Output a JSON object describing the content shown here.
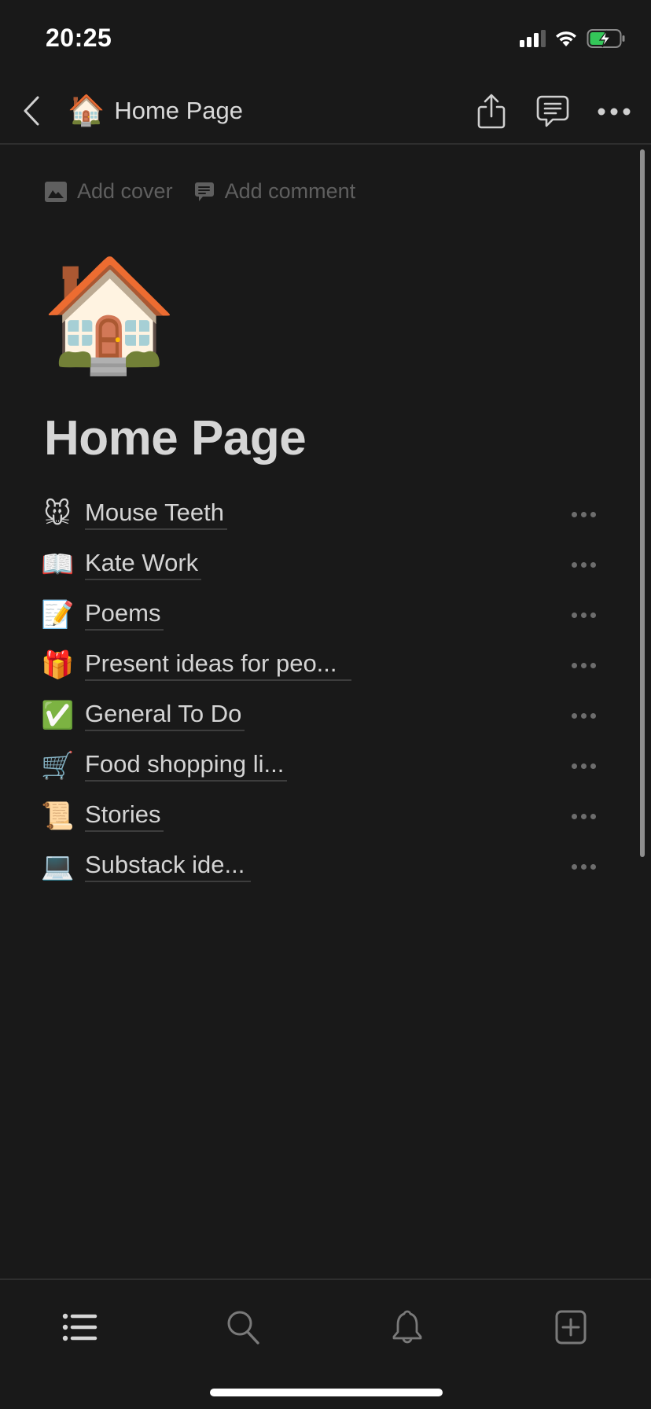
{
  "status_bar": {
    "time": "20:25",
    "signal_bars_filled": 3,
    "signal_bars_total": 4,
    "wifi_icon": "wifi-icon",
    "battery_icon": "battery-charging-icon",
    "battery_level": 0.5,
    "battery_color": "#34c759"
  },
  "nav_header": {
    "back_icon": "chevron-left-icon",
    "emoji": "🏠",
    "title": "Home Page",
    "actions": [
      {
        "name": "share",
        "icon": "share-icon"
      },
      {
        "name": "comments",
        "icon": "comment-icon"
      },
      {
        "name": "more",
        "icon": "ellipsis-icon"
      }
    ]
  },
  "page_actions": {
    "add_cover": {
      "label": "Add cover",
      "icon": "image-icon"
    },
    "add_comment": {
      "label": "Add comment",
      "icon": "comment-icon"
    }
  },
  "page": {
    "icon": "🏠",
    "title": "Home Page"
  },
  "subpages": [
    {
      "emoji": "🐭",
      "label": "Mouse Teeth"
    },
    {
      "emoji": "📖",
      "label": "Kate Work"
    },
    {
      "emoji": "📝",
      "label": "Poems"
    },
    {
      "emoji": "🎁",
      "label": "Present ideas for peo..."
    },
    {
      "emoji": "✅",
      "label": "General To Do"
    },
    {
      "emoji": "🛒",
      "label": "Food shopping li..."
    },
    {
      "emoji": "📜",
      "label": "Stories"
    },
    {
      "emoji": "💻",
      "label": "Substack ide..."
    }
  ],
  "tab_bar": {
    "tabs": [
      {
        "name": "sidebar",
        "icon": "list-icon"
      },
      {
        "name": "search",
        "icon": "search-icon"
      },
      {
        "name": "updates",
        "icon": "bell-icon"
      },
      {
        "name": "new-page",
        "icon": "new-page-icon"
      }
    ]
  },
  "colors": {
    "background": "#191919",
    "text_primary": "#d4d4d4",
    "text_muted": "#5f5f5f",
    "divider": "#2e2e2e"
  }
}
